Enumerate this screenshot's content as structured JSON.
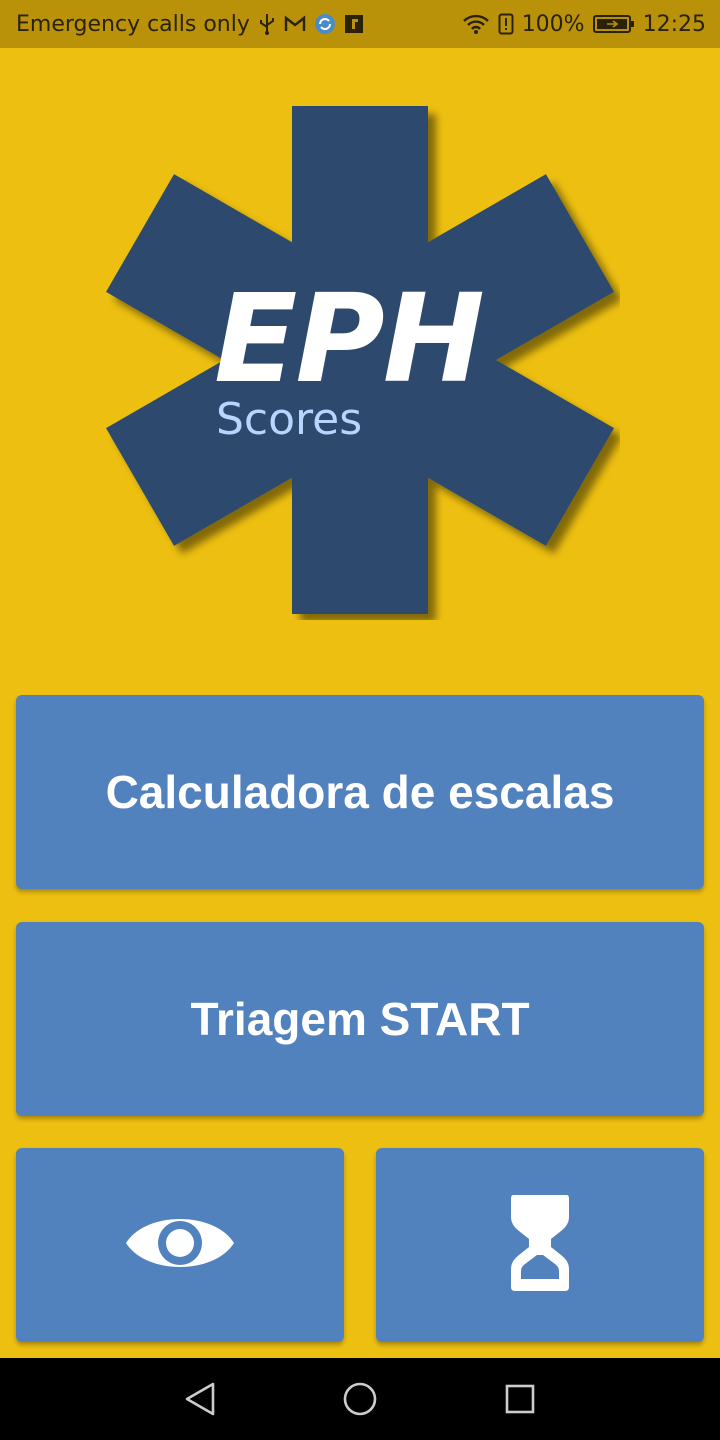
{
  "status_bar": {
    "carrier_text": "Emergency calls only",
    "battery_percent": "100%",
    "time": "12:25",
    "icons": [
      "usb-icon",
      "gmail-icon",
      "sync-app-icon",
      "flipboard-icon",
      "wifi-icon",
      "alert-icon",
      "battery-icon"
    ]
  },
  "logo": {
    "title": "EPH",
    "subtitle": "Scores",
    "icon": "star-of-life-icon",
    "colors": {
      "star": "#2E4A6E",
      "title": "#FFFFFF",
      "subtitle": "#B7D5FF"
    }
  },
  "buttons": {
    "calculator_label": "Calculadora de escalas",
    "triage_label": "Triagem START",
    "eye_icon": "eye-icon",
    "timer_icon": "hourglass-icon"
  },
  "nav": {
    "icons": [
      "back-icon",
      "home-icon",
      "recents-icon"
    ]
  },
  "colors": {
    "background": "#EDBF10",
    "status_bar": "#B9920A",
    "button": "#5182BD",
    "nav_bar": "#000000"
  }
}
